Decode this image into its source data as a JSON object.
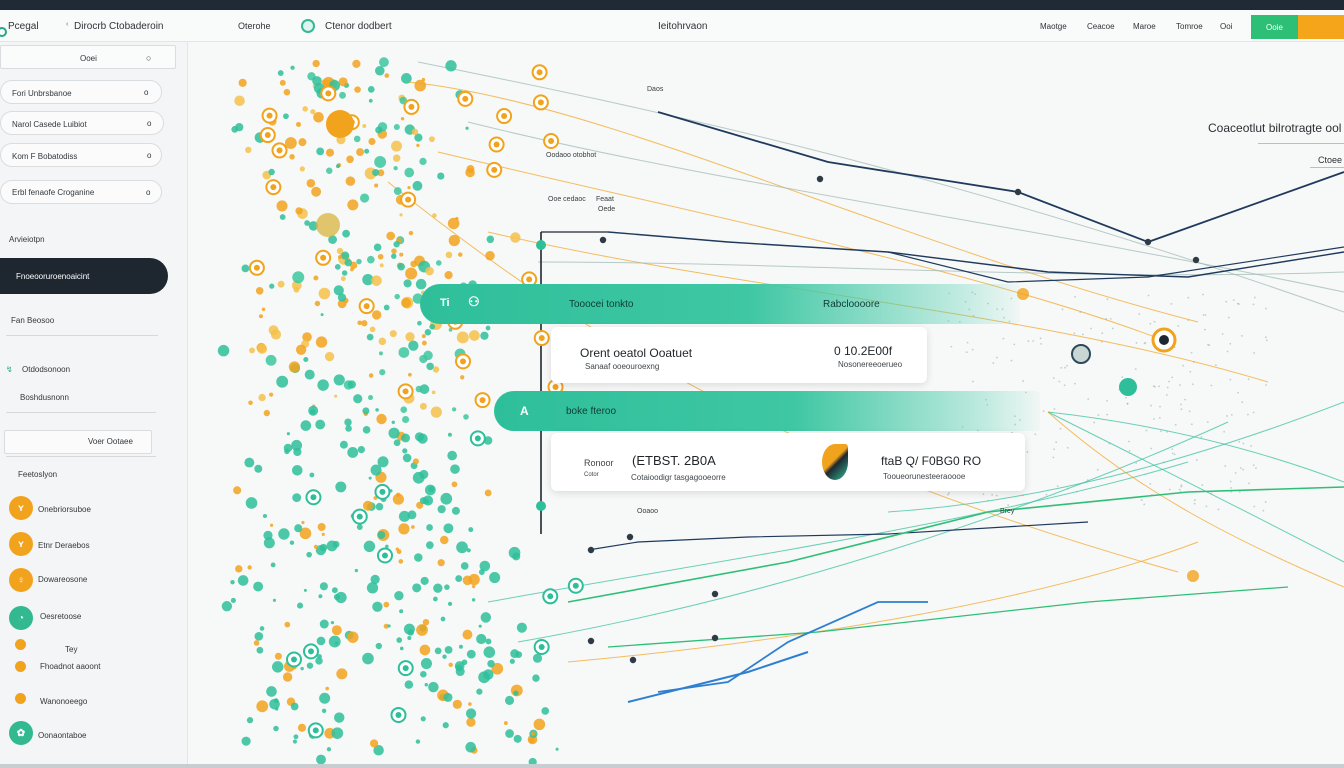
{
  "header": {
    "brand": "Pcegal",
    "app_title": "Dirocrb Ctobaderoin",
    "tab_1": "Oterohe",
    "tab_2": "Ctenor dodbert",
    "center_title": "Ieitohrvaon",
    "nav": [
      "Maotge",
      "Ceacoe",
      "Maroe",
      "Tomroe",
      "Ooi"
    ],
    "btn_green": "Ooie",
    "btn_orange": ""
  },
  "sidebar": {
    "search_value": "Ooei",
    "fields": [
      {
        "label": "Fori Unbrsbanoe",
        "icon": "o"
      },
      {
        "label": "Narol Casede Luibiot",
        "icon": "o"
      },
      {
        "label": "Kom F Bobatodiss",
        "icon": "o"
      },
      {
        "label": "Erbl fenaofe Croganine",
        "icon": "o"
      }
    ],
    "section_1": "Arvieiotpn",
    "active_item": "Fnoeooruroenoaicint",
    "item_2": "Fan Beosoo",
    "item_3": "Otdodsonoon",
    "item_4": "Boshdusnonn",
    "button": "Voer Ootaee",
    "section_2": "Feetoslyon",
    "people": [
      {
        "label": "Onebriorsuboe",
        "color": "#f2a31d",
        "icon": "ʏ"
      },
      {
        "label": "Etnr Deraebos",
        "color": "#f2a31d",
        "icon": "ʏ"
      },
      {
        "label": "Dowareosone",
        "color": "#f2a31d",
        "icon": "♀"
      },
      {
        "label": "Oesretoose",
        "color": "#33b98f",
        "icon": "◔"
      }
    ],
    "mini": [
      {
        "label": "Tey",
        "color": "#f2a31d"
      },
      {
        "label": "Fhoadnot aaoont",
        "color": "#f2a31d"
      },
      {
        "label": "Wanonoeego",
        "color": "#f2a31d"
      },
      {
        "label": "Oonaontaboe",
        "color": "#33b98f"
      }
    ]
  },
  "panel": {
    "title": "Coaceotlut bilrotragte ool",
    "sub": "Ctoee"
  },
  "flow": {
    "bar1_icon": "Ti",
    "bar1_left": "Tooocei tonkto",
    "bar1_right": "Rabcloooore",
    "card1_name": "Orent oeatol Ooatuet",
    "card1_name_sub": "Sanaaf ooeouroexng",
    "card1_value": "0 10.2E00f",
    "card1_value_sub": "Nosonereeoerueo",
    "bar2_icon": "A",
    "bar2_label": "boke fteroo",
    "card2_left": "Ronoor",
    "card2_left_sub": "Cotor",
    "card2_value": "(ETBST. 2B0A",
    "card2_value_sub": "Cotaioodigr tasgagooeorre",
    "card2_right": "ftaB Q/ F0BG0 RO",
    "card2_right_sub": "Tooueorunesteeraoooe"
  },
  "floating_labels": [
    "Daos",
    "Oodaoo otobhot",
    "Ooe cedaoc",
    "Feaat",
    "Oede",
    "Ooaoo",
    "Brey"
  ],
  "colors": {
    "accent_green": "#2ebf9a",
    "accent_orange": "#f2a31d",
    "dark": "#1e2730",
    "navy_line": "#1f3a5c",
    "blue_line": "#2f7fd0"
  }
}
